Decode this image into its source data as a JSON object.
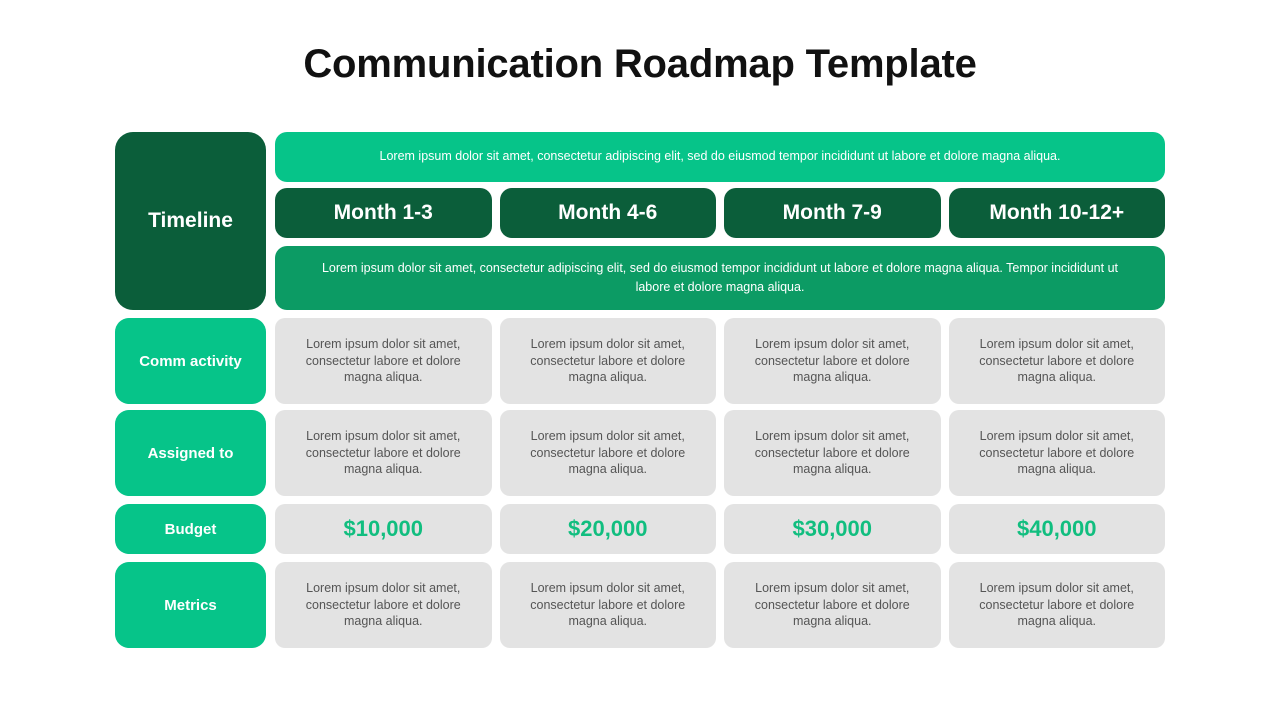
{
  "slide": {
    "title": "Communication Roadmap Template"
  },
  "timeline": {
    "label": "Timeline",
    "top_banner": "Lorem ipsum dolor sit amet, consectetur adipiscing elit, sed do eiusmod tempor incididunt ut labore et dolore magna aliqua.",
    "bottom_banner": "Lorem ipsum dolor sit amet, consectetur adipiscing elit, sed do eiusmod tempor incididunt ut labore et dolore magna aliqua. Tempor incididunt ut labore et dolore magna aliqua.",
    "months": [
      "Month 1-3",
      "Month 4-6",
      "Month 7-9",
      "Month 10-12+"
    ]
  },
  "rows": [
    {
      "label": "Comm activity",
      "cells": [
        "Lorem ipsum dolor sit amet, consectetur labore et dolore magna aliqua.",
        "Lorem ipsum dolor sit amet, consectetur labore et dolore magna aliqua.",
        "Lorem ipsum dolor sit amet, consectetur labore et dolore magna aliqua.",
        "Lorem ipsum dolor sit amet, consectetur labore et dolore magna aliqua."
      ]
    },
    {
      "label": "Assigned to",
      "cells": [
        "Lorem ipsum dolor sit amet, consectetur labore et dolore magna aliqua.",
        "Lorem ipsum dolor sit amet, consectetur labore et dolore magna aliqua.",
        "Lorem ipsum dolor sit amet, consectetur labore et dolore magna aliqua.",
        "Lorem ipsum dolor sit amet, consectetur labore et dolore magna aliqua."
      ]
    },
    {
      "label": "Budget",
      "cells": [
        "$10,000",
        "$20,000",
        "$30,000",
        "$40,000"
      ]
    },
    {
      "label": "Metrics",
      "cells": [
        "Lorem ipsum dolor sit amet, consectetur labore et dolore magna aliqua.",
        "Lorem ipsum dolor sit amet, consectetur labore et dolore magna aliqua.",
        "Lorem ipsum dolor sit amet, consectetur labore et dolore magna aliqua.",
        "Lorem ipsum dolor sit amet, consectetur labore et dolore magna aliqua."
      ]
    }
  ],
  "colors": {
    "dark_green": "#0B5E3A",
    "bright_green": "#06C489",
    "mid_green": "#0C9B64",
    "cell_gray": "#E3E3E3",
    "cell_text": "#555555",
    "money_green": "#11BE7F",
    "title_black": "#111111"
  }
}
